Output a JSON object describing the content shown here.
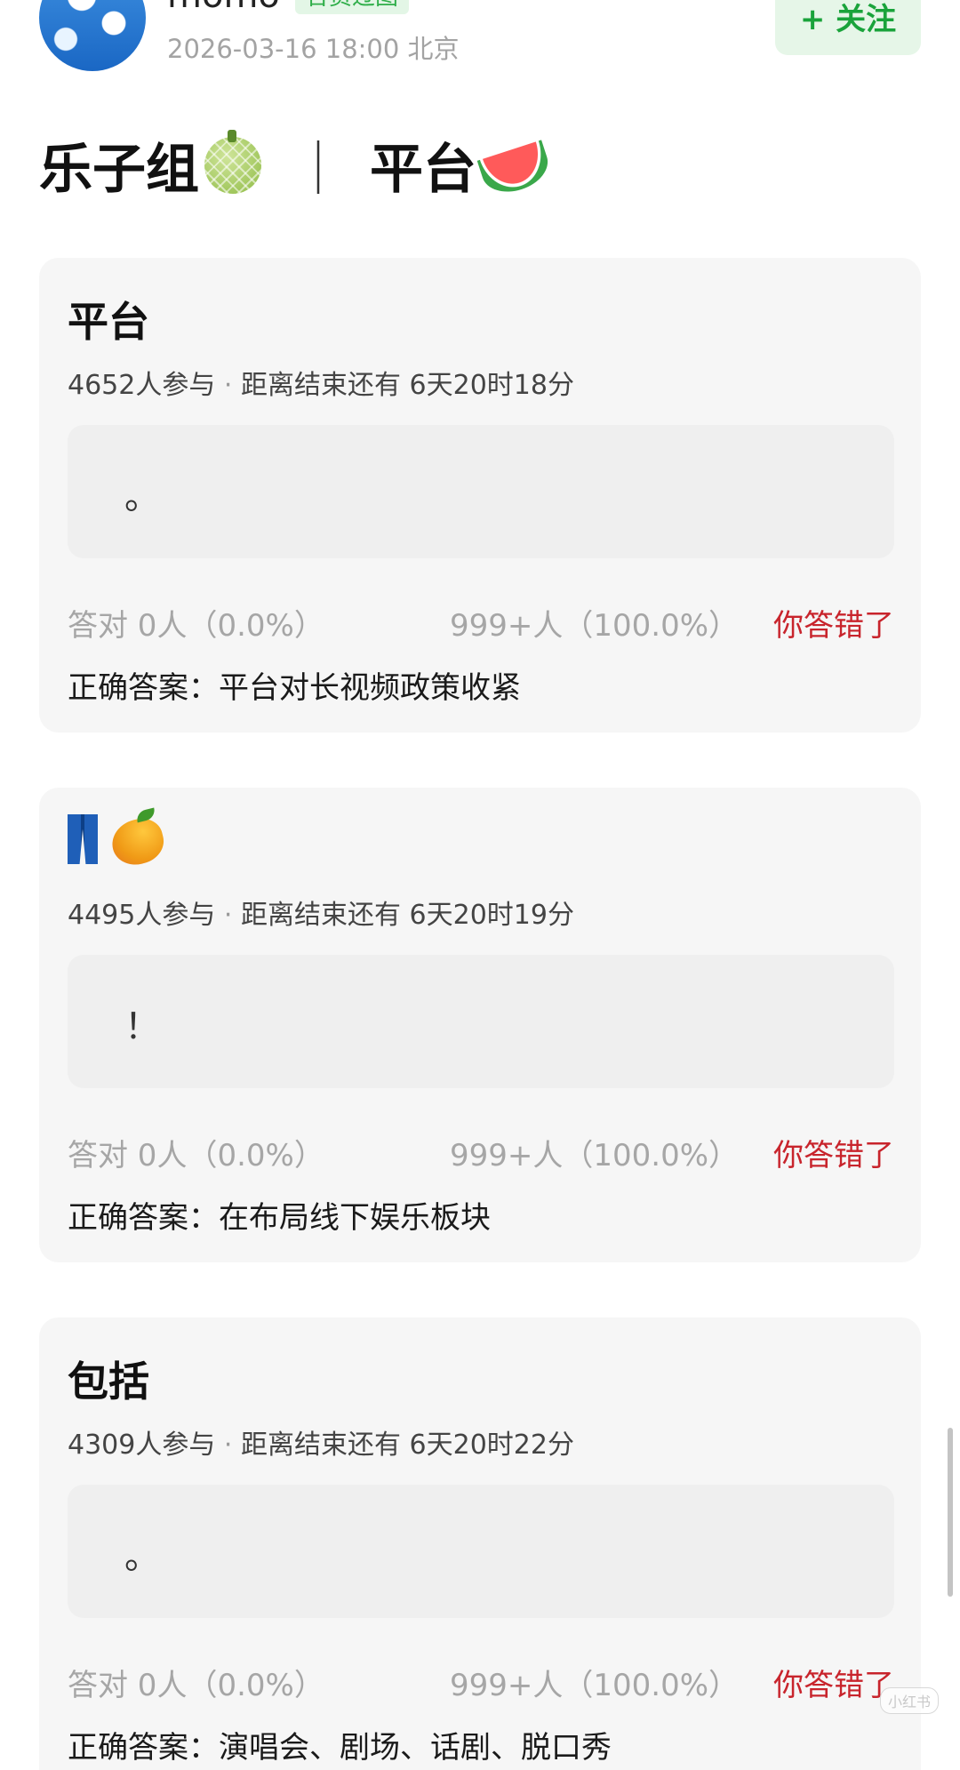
{
  "header": {
    "username": "momo",
    "badge": "合资过图",
    "meta": "2026-03-16 18:00  北京",
    "follow_label": "+ 关注"
  },
  "title": {
    "left": "乐子组",
    "separator": "｜",
    "right": "平台",
    "left_icon": "melon-icon",
    "right_icon": "watermelon-icon"
  },
  "cards": [
    {
      "title": "平台",
      "participants": "4652人参与",
      "separator": "·",
      "countdown": "距离结束还有 6天20时18分",
      "answer": "。",
      "correct_stat": "答对  0人（0.0%）",
      "answer_count": "999+人（100.0%）",
      "result": "你答错了",
      "correct_answer": "正确答案：平台对长视频政策收紧"
    },
    {
      "title_icons": [
        "jeans-icon",
        "mango-icon"
      ],
      "participants": "4495人参与",
      "separator": "·",
      "countdown": "距离结束还有 6天20时19分",
      "answer": "！",
      "correct_stat": "答对  0人（0.0%）",
      "answer_count": "999+人（100.0%）",
      "result": "你答错了",
      "correct_answer": "正确答案：在布局线下娱乐板块"
    },
    {
      "title": "包括",
      "participants": "4309人参与",
      "separator": "·",
      "countdown": "距离结束还有 6天20时22分",
      "answer": "。",
      "correct_stat": "答对  0人（0.0%）",
      "answer_count": "999+人（100.0%）",
      "result": "你答错了",
      "correct_answer": "正确答案：演唱会、剧场、话剧、脱口秀"
    }
  ],
  "watermark": "小红书",
  "colors": {
    "accent_green": "#1aa33b",
    "wrong_red": "#c8242c",
    "card_bg": "#f6f6f6"
  }
}
